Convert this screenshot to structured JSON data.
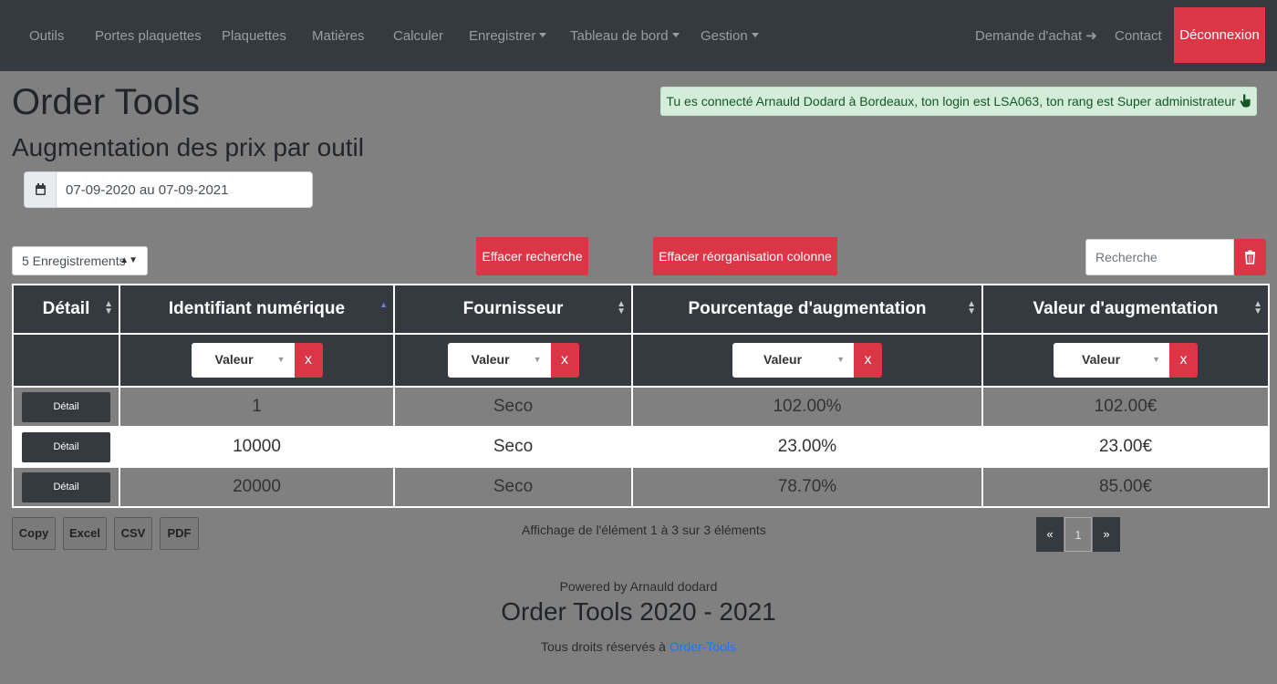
{
  "nav": {
    "items": [
      {
        "label": "Outils",
        "dropdown": false
      },
      {
        "label": "Portes plaquettes",
        "dropdown": false
      },
      {
        "label": "Plaquettes",
        "dropdown": false
      },
      {
        "label": "Matières",
        "dropdown": false
      },
      {
        "label": "Calculer",
        "dropdown": false
      },
      {
        "label": "Enregistrer",
        "dropdown": true
      },
      {
        "label": "Tableau de bord",
        "dropdown": true
      },
      {
        "label": "Gestion",
        "dropdown": true
      }
    ],
    "purchase_request": "Demande d'achat",
    "contact": "Contact",
    "logout": "Déconnexion"
  },
  "page": {
    "title": "Order Tools",
    "subtitle": "Augmentation des prix par outil",
    "login_alert": "Tu es connecté Arnauld Dodard à Bordeaux, ton login est LSA063, ton rang est Super administrateur",
    "date_range": "07-09-2020 au 07-09-2021"
  },
  "controls": {
    "page_length": "5 Enregistrements",
    "clear_search": "Effacer recherche",
    "clear_column_order": "Effacer réorganisation colonne",
    "search_placeholder": "Recherche"
  },
  "table": {
    "columns": [
      "Détail",
      "Identifiant numérique",
      "Fournisseur",
      "Pourcentage d'augmentation",
      "Valeur d'augmentation"
    ],
    "filter_label": "Valeur",
    "filter_clear": "x",
    "detail_label": "Détail",
    "rows": [
      {
        "id": "1",
        "supplier": "Seco",
        "percent": "102.00%",
        "value": "102.00€"
      },
      {
        "id": "10000",
        "supplier": "Seco",
        "percent": "23.00%",
        "value": "23.00€"
      },
      {
        "id": "20000",
        "supplier": "Seco",
        "percent": "78.70%",
        "value": "85.00€"
      }
    ]
  },
  "export": {
    "copy": "Copy",
    "excel": "Excel",
    "csv": "CSV",
    "pdf": "PDF"
  },
  "info": "Affichage de l'élément 1 à 3 sur 3 éléments",
  "pagination": {
    "prev": "«",
    "current": "1",
    "next": "»"
  },
  "footer": {
    "powered": "Powered by Arnauld dodard",
    "title": "Order Tools 2020 - 2021",
    "rights": "Tous droits réservés à",
    "link": "Order-Tools"
  }
}
